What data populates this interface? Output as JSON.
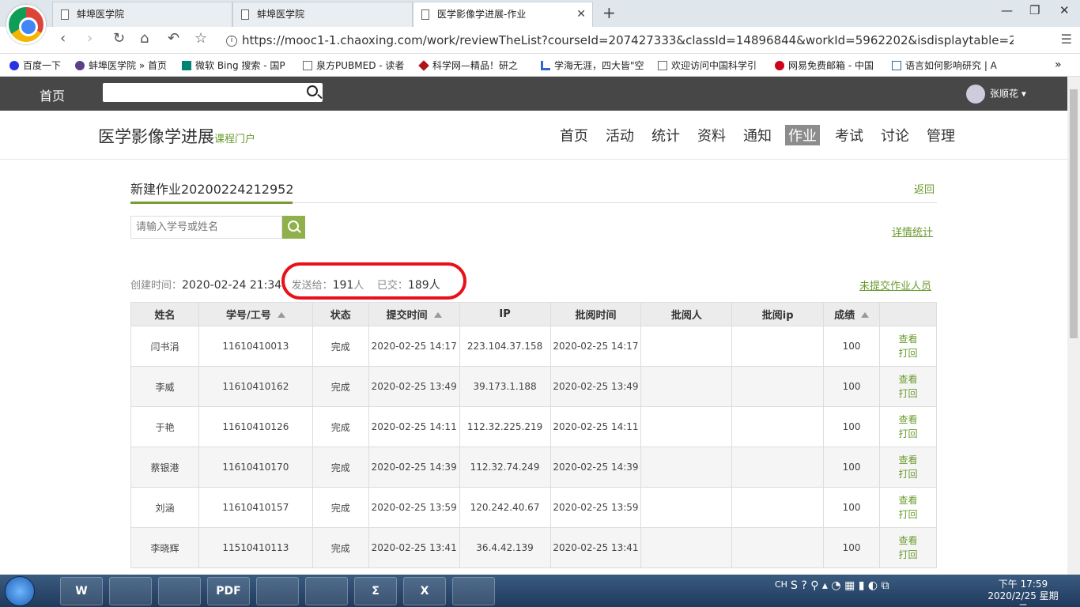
{
  "browser": {
    "tabs": [
      {
        "title": "蚌埠医学院"
      },
      {
        "title": "蚌埠医学院"
      },
      {
        "title": "医学影像学进展-作业"
      }
    ],
    "url": "https://mooc1-1.chaoxing.com/work/reviewTheList?courseId=207427333&classId=14896844&workId=5962202&isdisplaytable=2&..."
  },
  "bookmarks": [
    {
      "label": "百度一下",
      "icon": "baidu-icon",
      "color": "#2932e1"
    },
    {
      "label": "蚌埠医学院 » 首页",
      "icon": "school-icon",
      "color": "#5b3f8c"
    },
    {
      "label": "微软 Bing 搜索 - 国P",
      "icon": "bing-icon",
      "color": "#008373"
    },
    {
      "label": "泉方PUBMED - 读者",
      "icon": "page-icon",
      "color": "#666666"
    },
    {
      "label": "科学网—精品！研之",
      "icon": "science-icon",
      "color": "#b0131a"
    },
    {
      "label": "学海无涯，四大皆\"空",
      "icon": "hook-icon",
      "color": "#3366cc"
    },
    {
      "label": "欢迎访问中国科学引",
      "icon": "page-icon",
      "color": "#666666"
    },
    {
      "label": "网易免费邮箱 - 中国",
      "icon": "netease-icon",
      "color": "#d0021b"
    },
    {
      "label": "语言如何影响研究 | A",
      "icon": "article-icon",
      "color": "#336699"
    }
  ],
  "header": {
    "home": "首页",
    "search_value": "",
    "user": "张顺花"
  },
  "course": {
    "title": "医学影像学进展",
    "portal": "课程门户",
    "nav": [
      "首页",
      "活动",
      "统计",
      "资料",
      "通知",
      "作业",
      "考试",
      "讨论",
      "管理"
    ],
    "active_nav": "作业"
  },
  "homework": {
    "title": "新建作业20200224212952",
    "back": "返回",
    "search_placeholder": "请输入学号或姓名",
    "detail_stats": "详情统计",
    "unsubmitted": "未提交作业人员",
    "created_label": "创建时间：",
    "created_value": "2020-02-24 21:34",
    "sent_label": "发送给：",
    "sent_value": "191",
    "sent_unit": "人",
    "submitted_label": "已交：",
    "submitted_value": "189",
    "submitted_unit": "人"
  },
  "table": {
    "columns": [
      "姓名",
      "学号/工号",
      "状态",
      "提交时间",
      "IP",
      "批阅时间",
      "批阅人",
      "批阅ip",
      "成绩",
      ""
    ],
    "sortable": [
      false,
      true,
      false,
      true,
      false,
      false,
      false,
      false,
      true,
      false
    ],
    "action_view": "查看",
    "action_return": "打回",
    "rows": [
      [
        "闫书涓",
        "11610410013",
        "完成",
        "2020-02-25 14:17",
        "223.104.37.158",
        "2020-02-25 14:17",
        "",
        "",
        "100"
      ],
      [
        "李威",
        "11610410162",
        "完成",
        "2020-02-25 13:49",
        "39.173.1.188",
        "2020-02-25 13:49",
        "",
        "",
        "100"
      ],
      [
        "于艳",
        "11610410126",
        "完成",
        "2020-02-25 14:11",
        "112.32.225.219",
        "2020-02-25 14:11",
        "",
        "",
        "100"
      ],
      [
        "蔡银港",
        "11610410170",
        "完成",
        "2020-02-25 14:39",
        "112.32.74.249",
        "2020-02-25 14:39",
        "",
        "",
        "100"
      ],
      [
        "刘涵",
        "11610410157",
        "完成",
        "2020-02-25 13:59",
        "120.242.40.67",
        "2020-02-25 13:59",
        "",
        "",
        "100"
      ],
      [
        "李晓辉",
        "11510410113",
        "完成",
        "2020-02-25 13:41",
        "36.4.42.139",
        "2020-02-25 13:41",
        "",
        "",
        "100"
      ]
    ]
  },
  "taskbar": {
    "apps": [
      "W",
      "",
      "",
      "PDF",
      "",
      "",
      "Σ",
      "X",
      ""
    ],
    "lang": "CH",
    "time": "下午 17:59",
    "date": "2020/2/25 星期二"
  },
  "colors": {
    "accent_green": "#6a9b2d",
    "highlight_red": "#e8101a",
    "header_gray": "#474747"
  }
}
